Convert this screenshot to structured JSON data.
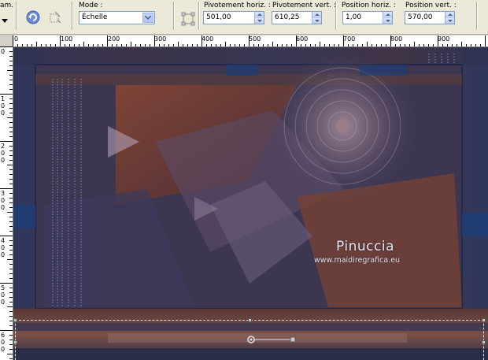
{
  "toolbar": {
    "left_partial_label": "am. :",
    "mode_label": "Mode :",
    "mode_value": "Échelle",
    "pivot_h_label": "Pivotement horiz. :",
    "pivot_h_value": "501,00",
    "pivot_v_label": "Pivotement vert. :",
    "pivot_v_value": "610,25",
    "pos_h_label": "Position horiz. :",
    "pos_h_value": "1,00",
    "pos_v_label": "Position vert. :",
    "pos_v_value": "570,00"
  },
  "ruler_top": {
    "labels": [
      "0",
      "100",
      "200",
      "300",
      "400",
      "500",
      "600",
      "700",
      "800",
      "900"
    ]
  },
  "ruler_left": {
    "labels": [
      "0",
      "100",
      "200",
      "300",
      "400",
      "500",
      "600"
    ]
  },
  "canvas": {
    "watermark_name": "Pinuccia",
    "watermark_url": "www.maidiregrafica.eu"
  },
  "colors": {
    "rust": "#7a3d2a",
    "navy": "#1f3462",
    "mauve": "#6e5c73",
    "selection": "#e6e6e6"
  }
}
